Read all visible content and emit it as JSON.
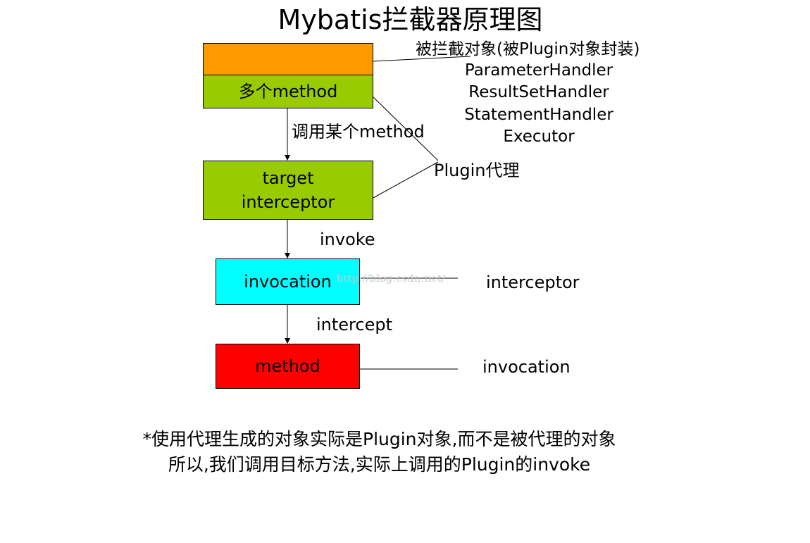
{
  "title": "Mybatis拦截器原理图",
  "boxes": {
    "target_object": {
      "label": "",
      "color": "#FF9900"
    },
    "methods": {
      "label": "多个method",
      "color": "#99CC00"
    },
    "target": {
      "label": "target",
      "color": "#99CC00"
    },
    "interceptor": {
      "label": "interceptor"
    },
    "invocation": {
      "label": "invocation",
      "color": "#00FFFF"
    },
    "method": {
      "label": "method",
      "color": "#FF0000"
    }
  },
  "labels": {
    "intercepted_objects": "被拦截对象(被Plugin对象封装)",
    "handler_types": [
      "ParameterHandler",
      "ResultSetHandler",
      "StatementHandler",
      "Executor"
    ],
    "call_some_method": "调用某个method",
    "plugin_proxy": "Plugin代理",
    "invoke": "invoke",
    "interceptor_side": "interceptor",
    "intercept": "intercept",
    "invocation_side": "invocation"
  },
  "watermark": "http://blog.csdn.net/",
  "notes": [
    "*使用代理生成的对象实际是Plugin对象,而不是被代理的对象",
    "所以,我们调用目标方法,实际上调用的Plugin的invoke"
  ]
}
